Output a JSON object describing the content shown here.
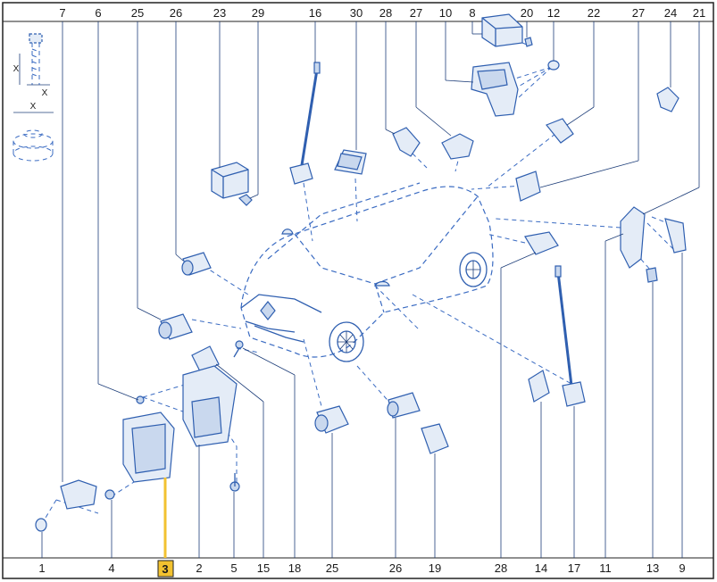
{
  "diagram": {
    "highlight_color": "#f2c230",
    "line_color": "#2f5fb0",
    "highlighted_label": "3",
    "top_labels": [
      "7",
      "6",
      "25",
      "26",
      "23",
      "29",
      "16",
      "30",
      "28",
      "27",
      "10",
      "8",
      "20",
      "12",
      "22",
      "27",
      "24",
      "21"
    ],
    "bottom_labels": [
      "1",
      "4",
      "3",
      "2",
      "5",
      "15",
      "18",
      "25",
      "26",
      "19",
      "28",
      "14",
      "17",
      "11",
      "13",
      "9"
    ],
    "legend": {
      "x_mark": "X"
    }
  }
}
